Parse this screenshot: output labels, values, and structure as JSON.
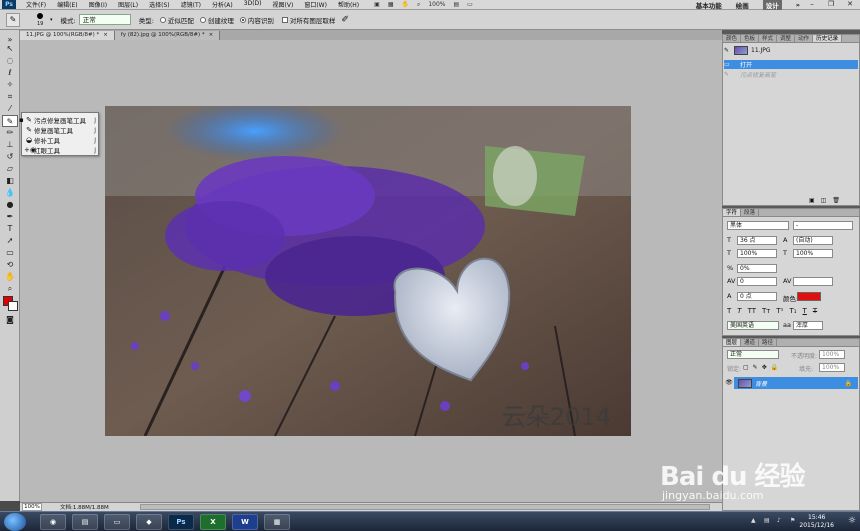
{
  "menubar": {
    "items": [
      "文件(F)",
      "编辑(E)",
      "图像(I)",
      "图层(L)",
      "选择(S)",
      "滤镜(T)",
      "分析(A)",
      "3D(D)",
      "视图(V)",
      "窗口(W)",
      "帮助(H)"
    ],
    "zoom": "100%",
    "workspaces": [
      "基本功能",
      "绘画",
      "设计"
    ],
    "active_workspace": "设计"
  },
  "options": {
    "brush_size": "19",
    "mode_label": "模式:",
    "mode_value": "正常",
    "type_label": "类型:",
    "type_options": [
      "近似匹配",
      "创建纹理",
      "内容识别"
    ],
    "type_selected": "内容识别",
    "sample_all_label": "对所有图层取样"
  },
  "doc_tabs": [
    {
      "label": "11.JPG @ 100%(RGB/8#) *",
      "active": true
    },
    {
      "label": "fy (82).jpg @ 100%(RGB/8#) *",
      "active": false
    }
  ],
  "flyout": {
    "items": [
      {
        "label": "污点修复画笔工具",
        "shortcut": "J",
        "selected": true
      },
      {
        "label": "修复画笔工具",
        "shortcut": "J",
        "selected": false
      },
      {
        "label": "修补工具",
        "shortcut": "J",
        "selected": false
      },
      {
        "label": "红眼工具",
        "shortcut": "J",
        "selected": false
      }
    ]
  },
  "canvas": {
    "watermark": "云朵2014"
  },
  "status": {
    "zoom": "100%",
    "doc_info": "文档:1.88M/1.88M"
  },
  "history_panel": {
    "tabs": [
      "颜色",
      "色板",
      "样式",
      "调整",
      "动作",
      "历史记录"
    ],
    "active_tab": "历史记录",
    "snapshot": "11.JPG",
    "rows": [
      {
        "label": "打开",
        "selected": true
      },
      {
        "label": "污点修复画笔",
        "dim": true
      }
    ]
  },
  "character_panel": {
    "tabs": [
      "字符",
      "段落"
    ],
    "font_family": "黑体",
    "font_style": "-",
    "font_size": "36 点",
    "leading": "(自动)",
    "vscale": "100%",
    "hscale": "100%",
    "tracking_pct": "0%",
    "kerning": "0",
    "baseline": "0 点",
    "color_label": "颜色:",
    "color_value": "#e01010",
    "language": "美国英语",
    "aa_label": "aa",
    "aa_value": "浑厚"
  },
  "layers_panel": {
    "tabs": [
      "图层",
      "通道",
      "路径"
    ],
    "blend_mode": "正常",
    "opacity_label": "不透明度:",
    "opacity": "100%",
    "lock_label": "锁定:",
    "fill_label": "填充:",
    "fill": "100%",
    "layer_name": "背景"
  },
  "taskbar": {
    "time": "15:46",
    "date": "2015/12/16"
  },
  "baidu": {
    "logo": "Bai du 经验",
    "url": "jingyan.baidu.com"
  }
}
